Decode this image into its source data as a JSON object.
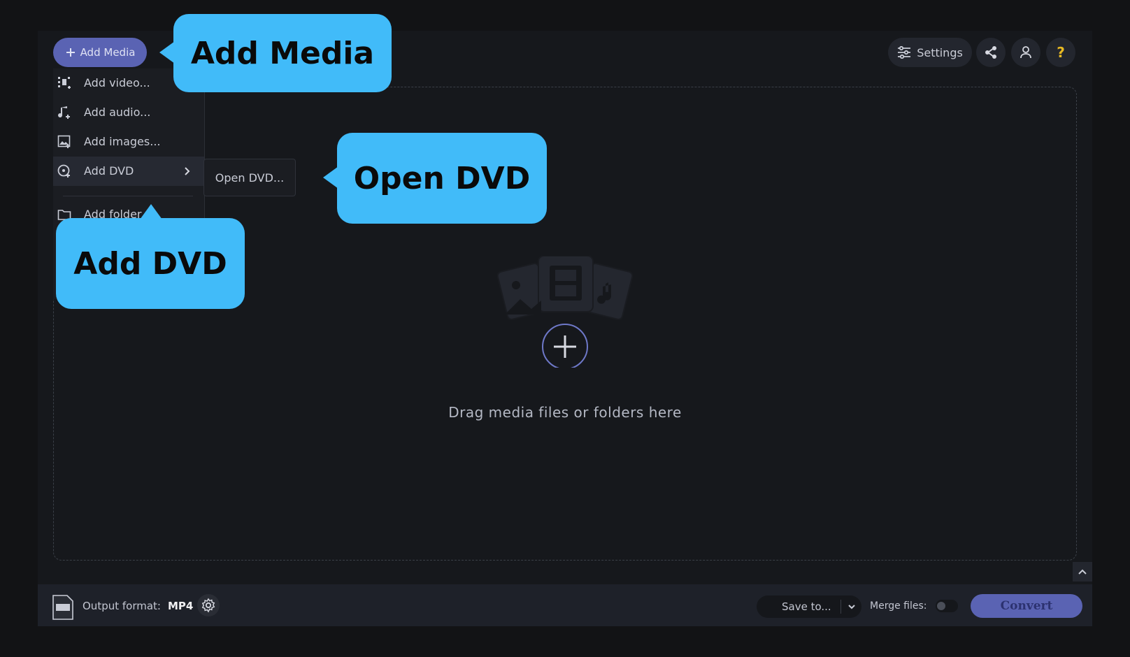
{
  "toolbar": {
    "add_media_label": "Add Media",
    "settings_label": "Settings"
  },
  "add_media_menu": {
    "items": [
      {
        "label": "Add video...",
        "icon": "add-video-icon"
      },
      {
        "label": "Add audio...",
        "icon": "add-audio-icon"
      },
      {
        "label": "Add images...",
        "icon": "add-images-icon"
      },
      {
        "label": "Add DVD",
        "icon": "add-dvd-icon",
        "has_submenu": true
      },
      {
        "label": "Add folder",
        "icon": "add-folder-icon"
      }
    ],
    "dvd_submenu": {
      "open_label": "Open DVD..."
    }
  },
  "dropzone": {
    "hint": "Drag media files or folders here"
  },
  "bottombar": {
    "output_format_label": "Output format:",
    "output_format_value": "MP4",
    "save_to_label": "Save to...",
    "merge_files_label": "Merge files:",
    "merge_files_on": false,
    "convert_label": "Convert"
  },
  "callouts": {
    "add_media": "Add Media",
    "open_dvd": "Open DVD",
    "add_dvd": "Add DVD"
  },
  "colors": {
    "accent": "#5a63b3",
    "callout": "#41bbf9",
    "background": "#16181c",
    "help_icon": "#e8b923"
  }
}
